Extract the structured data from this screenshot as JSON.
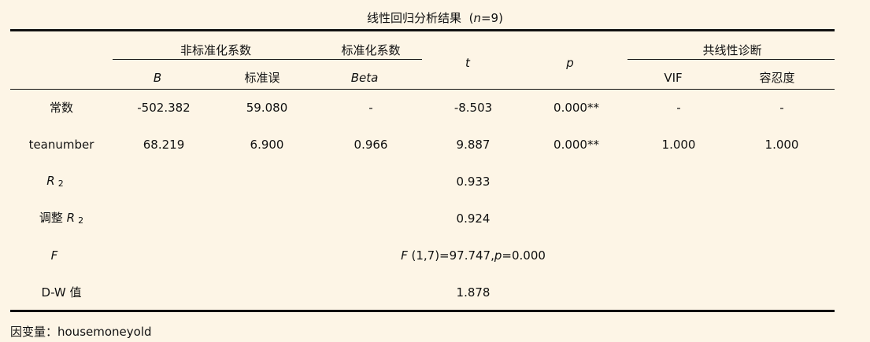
{
  "title": {
    "text": "线性回归分析结果",
    "paren_open": "(",
    "n_label": "n",
    "n_value": "=9",
    "paren_close": ")"
  },
  "header": {
    "group_unstd": "非标准化系数",
    "group_std": "标准化系数",
    "group_collin": "共线性诊断",
    "col_B": "B",
    "col_se": "标准误",
    "col_beta": "Beta",
    "col_t": "t",
    "col_p": "p",
    "col_vif": "VIF",
    "col_tol": "容忍度"
  },
  "rows": [
    {
      "label": "常数",
      "B": "-502.382",
      "se": "59.080",
      "beta": "-",
      "t": "-8.503",
      "p": "0.000**",
      "vif": "-",
      "tol": "-"
    },
    {
      "label": "teanumber",
      "B": "68.219",
      "se": "6.900",
      "beta": "0.966",
      "t": "9.887",
      "p": "0.000**",
      "vif": "1.000",
      "tol": "1.000"
    }
  ],
  "stats": {
    "r2_label_main": "R",
    "r2_label_sub": "2",
    "r2_value": "0.933",
    "adj_r2_prefix": "调整",
    "adj_r2_label_main": "R",
    "adj_r2_label_sub": "2",
    "adj_r2_value": "0.924",
    "f_label": "F",
    "f_value_F": "F",
    "f_value_mid": " (1,7)=97.747,",
    "f_value_p": "p",
    "f_value_end": "=0.000",
    "dw_label": "D-W 值",
    "dw_value": "1.878"
  },
  "footnote": "因变量：housemoneyold"
}
